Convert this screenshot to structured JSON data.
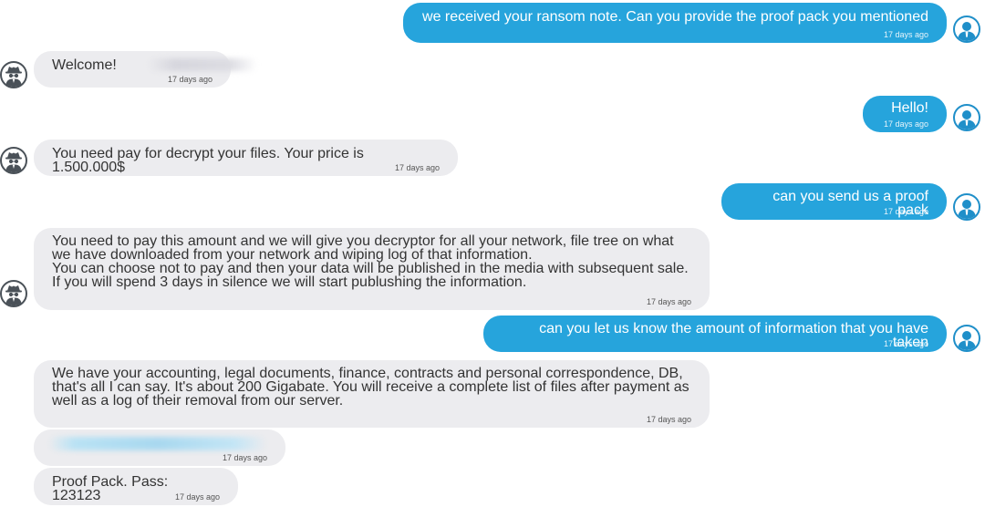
{
  "messages": [
    {
      "id": "m1",
      "side": "sent",
      "text": "we received your ransom note.  Can you provide the proof pack you mentioned",
      "time": "17 days ago"
    },
    {
      "id": "m2",
      "side": "recv",
      "text": "Welcome!",
      "time": "17 days ago"
    },
    {
      "id": "m3",
      "side": "sent",
      "text": "Hello!",
      "time": "17 days ago"
    },
    {
      "id": "m4",
      "side": "recv",
      "text": "You need pay for decrypt your files. Your price is 1.500.000$",
      "time": "17 days ago"
    },
    {
      "id": "m5",
      "side": "sent",
      "text": "can you send us a proof pack",
      "time": "17 days ago"
    },
    {
      "id": "m6",
      "side": "recv",
      "text": "You need to pay this amount and we will give you decryptor for all your network, file tree on what\nwe have downloaded from your network and wiping log of that information.\nYou can choose not to pay and then your data will be published in the media with subsequent sale.\nIf you will spend 3 days in silence we will start publushing the information.",
      "time": "17 days ago"
    },
    {
      "id": "m7",
      "side": "sent",
      "text": "can you let us know the amount of information that you have taken",
      "time": "17 days ago"
    },
    {
      "id": "m8",
      "side": "recv",
      "text": "We have your accounting, legal documents, finance,  contracts and personal correspondence, DB,\nthat's all I can say. It's about 200 Gigabate. You will receive a complete list of files after payment as\nwell as a log of their removal from our server.",
      "time": "17 days ago"
    },
    {
      "id": "m9",
      "side": "recv",
      "text": "",
      "time": "17 days ago"
    },
    {
      "id": "m10",
      "side": "recv",
      "text": "Proof Pack. Pass: 123123",
      "time": "17 days ago"
    }
  ],
  "colors": {
    "sent_bubble": "#26a4dc",
    "recv_bubble": "#ececef",
    "sent_avatar": "#1f8fc9",
    "recv_avatar": "#4a5158"
  },
  "icons": {
    "sent_avatar": "user-avatar-icon",
    "recv_avatar": "spy-avatar-icon"
  }
}
